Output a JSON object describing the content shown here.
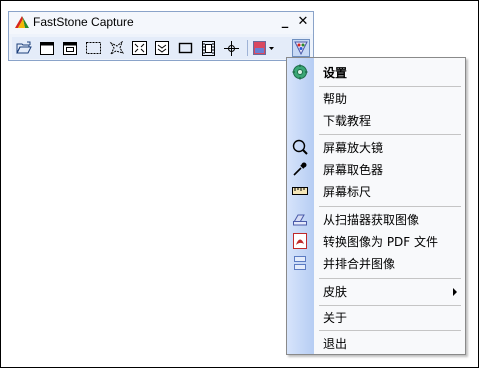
{
  "window": {
    "title": "FastStone Capture",
    "minimize_glyph": "_",
    "close_glyph": "✕"
  },
  "toolbar": {
    "tools": [
      {
        "name": "open-file-icon"
      },
      {
        "name": "capture-active-window-icon"
      },
      {
        "name": "capture-window-object-icon"
      },
      {
        "name": "capture-rectangular-region-icon"
      },
      {
        "name": "capture-freehand-region-icon"
      },
      {
        "name": "capture-full-screen-icon"
      },
      {
        "name": "capture-scrolling-window-icon"
      },
      {
        "name": "capture-fixed-region-icon"
      },
      {
        "name": "screen-recorder-icon"
      },
      {
        "name": "crosshair-icon"
      },
      {
        "name": "output-destination-icon"
      },
      {
        "name": "settings-menu-icon"
      }
    ]
  },
  "menu": {
    "items": [
      {
        "label": "设置",
        "icon": "gear-icon",
        "bold": true
      },
      {
        "label": "帮助",
        "icon": ""
      },
      {
        "label": "下载教程",
        "icon": ""
      },
      {
        "label": "屏幕放大镜",
        "icon": "magnifier-icon"
      },
      {
        "label": "屏幕取色器",
        "icon": "eyedropper-icon"
      },
      {
        "label": "屏幕标尺",
        "icon": "ruler-icon"
      },
      {
        "label": "从扫描器获取图像",
        "icon": "scanner-icon"
      },
      {
        "label": "转换图像为 PDF 文件",
        "icon": "pdf-icon"
      },
      {
        "label": "并排合并图像",
        "icon": "join-images-icon"
      },
      {
        "label": "皮肤",
        "icon": "",
        "submenu": true
      },
      {
        "label": "关于",
        "icon": ""
      },
      {
        "label": "退出",
        "icon": ""
      }
    ]
  },
  "colors": {
    "accent": "#d0e0f8",
    "menu_gutter": "#c4d7f6",
    "border": "#8aa3c9"
  }
}
